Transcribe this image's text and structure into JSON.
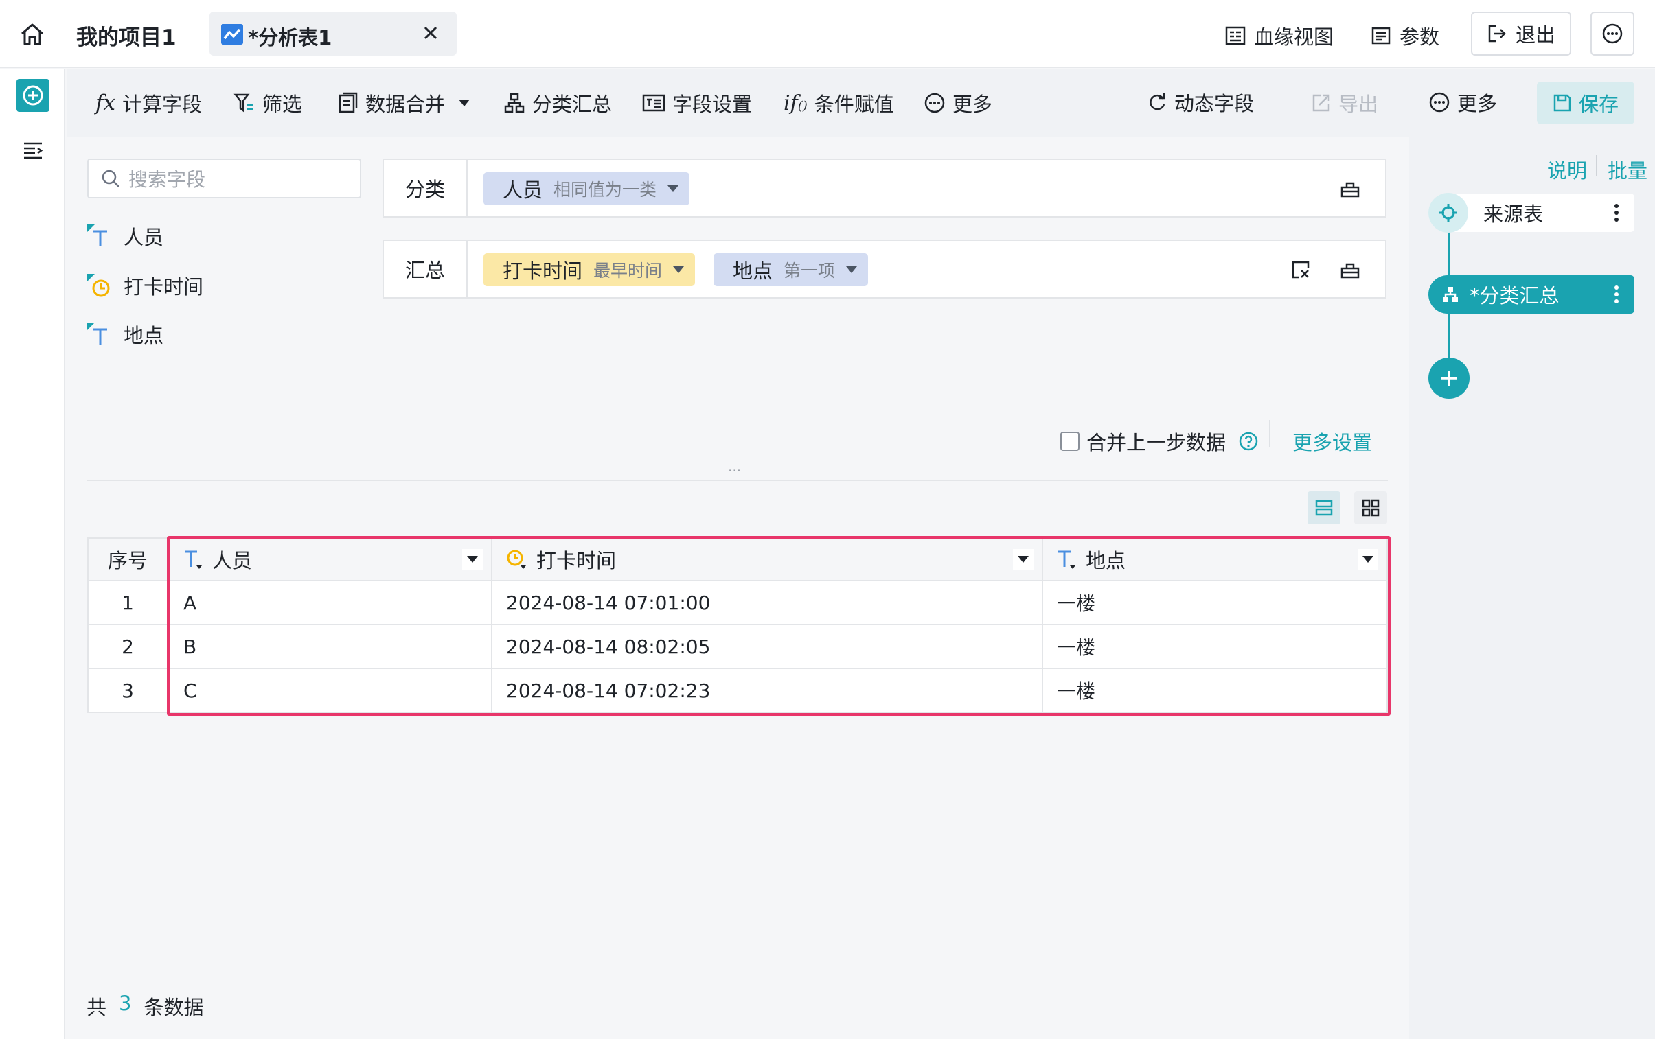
{
  "topbar": {
    "project_title": "我的项目1",
    "tab_label": "*分析表1",
    "lineage_label": "血缘视图",
    "params_label": "参数",
    "exit_label": "退出"
  },
  "toolbar": {
    "calc_field": "计算字段",
    "filter": "筛选",
    "merge": "数据合并",
    "group_summary": "分类汇总",
    "field_settings": "字段设置",
    "cond_assign": "条件赋值",
    "more": "更多",
    "dynamic_field": "动态字段",
    "export": "导出",
    "more2": "更多",
    "save": "保存"
  },
  "fields": {
    "search_placeholder": "搜索字段",
    "items": [
      {
        "label": "人员",
        "type": "text"
      },
      {
        "label": "打卡时间",
        "type": "datetime"
      },
      {
        "label": "地点",
        "type": "text"
      }
    ]
  },
  "config": {
    "group_label": "分类",
    "group_chip": {
      "name": "人员",
      "sub": "相同值为一类"
    },
    "summary_label": "汇总",
    "summary_chips": [
      {
        "name": "打卡时间",
        "sub": "最早时间"
      },
      {
        "name": "地点",
        "sub": "第一项"
      }
    ],
    "merge_prev_label": "合并上一步数据",
    "more_settings": "更多设置",
    "divider_dots": "..."
  },
  "table": {
    "index_header": "序号",
    "columns": [
      "人员",
      "打卡时间",
      "地点"
    ],
    "rows": [
      {
        "index": "1",
        "cells": [
          "A",
          "2024-08-14 07:01:00",
          "一楼"
        ]
      },
      {
        "index": "2",
        "cells": [
          "B",
          "2024-08-14 08:02:05",
          "一楼"
        ]
      },
      {
        "index": "3",
        "cells": [
          "C",
          "2024-08-14 07:02:23",
          "一楼"
        ]
      }
    ]
  },
  "footer": {
    "prefix": "共",
    "count": "3",
    "suffix": "条数据"
  },
  "rightpanel": {
    "explain": "说明",
    "batch": "批量",
    "source_node": "来源表",
    "current_node": "*分类汇总"
  },
  "colors": {
    "accent": "#1aa3b0",
    "highlight_border": "#e8366a",
    "chip_blue": "#d3dcf2",
    "chip_yellow": "#fbe8a6"
  }
}
